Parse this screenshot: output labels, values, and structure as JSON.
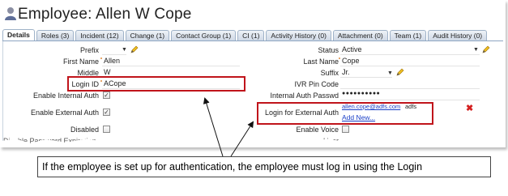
{
  "window": {
    "title": "Employee: Allen W Cope"
  },
  "tabs": [
    {
      "label": "Details",
      "active": true
    },
    {
      "label": "Roles (3)"
    },
    {
      "label": "Incident (12)"
    },
    {
      "label": "Change (1)"
    },
    {
      "label": "Contact Group (1)"
    },
    {
      "label": "CI (1)"
    },
    {
      "label": "Activity History (0)"
    },
    {
      "label": "Attachment (0)"
    },
    {
      "label": "Team (1)"
    },
    {
      "label": "Audit History (0)"
    }
  ],
  "left": {
    "prefix_label": "Prefix",
    "prefix_value": "",
    "first_name_label": "First Name",
    "first_name_value": "Allen",
    "middle_label": "Middle",
    "middle_value": "W",
    "login_id_label": "Login ID",
    "login_id_value": "ACope",
    "enable_internal_label": "Enable Internal Auth",
    "enable_internal_checked": "✓",
    "enable_external_label": "Enable External Auth",
    "enable_external_checked": "✓",
    "disabled_label": "Disabled",
    "cut_label": "Disable Password Expiration"
  },
  "right": {
    "status_label": "Status",
    "status_value": "Active",
    "last_name_label": "Last Name",
    "last_name_value": "Cope",
    "suffix_label": "Suffix",
    "suffix_value": "Jr.",
    "ivr_label": "IVR Pin Code",
    "ivr_value": "",
    "internal_pass_label": "Internal Auth Passwd",
    "internal_pass_value": "●●●●●●●●●●",
    "external_label": "Login for External Auth",
    "external_login": "allen.cope@adfs.com",
    "external_provider": "adfs",
    "add_new_label": "Add New...",
    "enable_voice_label": "Enable Voice",
    "cut_label": "User"
  },
  "caption": "If the employee is set up for authentication, the employee must log in using the Login",
  "colors": {
    "highlight_box": "#c0141b",
    "link": "#1a3fc7",
    "delete": "#d42020",
    "tab_border": "#8ea6c2"
  },
  "icons": [
    "user-icon",
    "pencil-icon",
    "dropdown-arrow-icon",
    "delete-x-icon",
    "checkbox-icon"
  ]
}
